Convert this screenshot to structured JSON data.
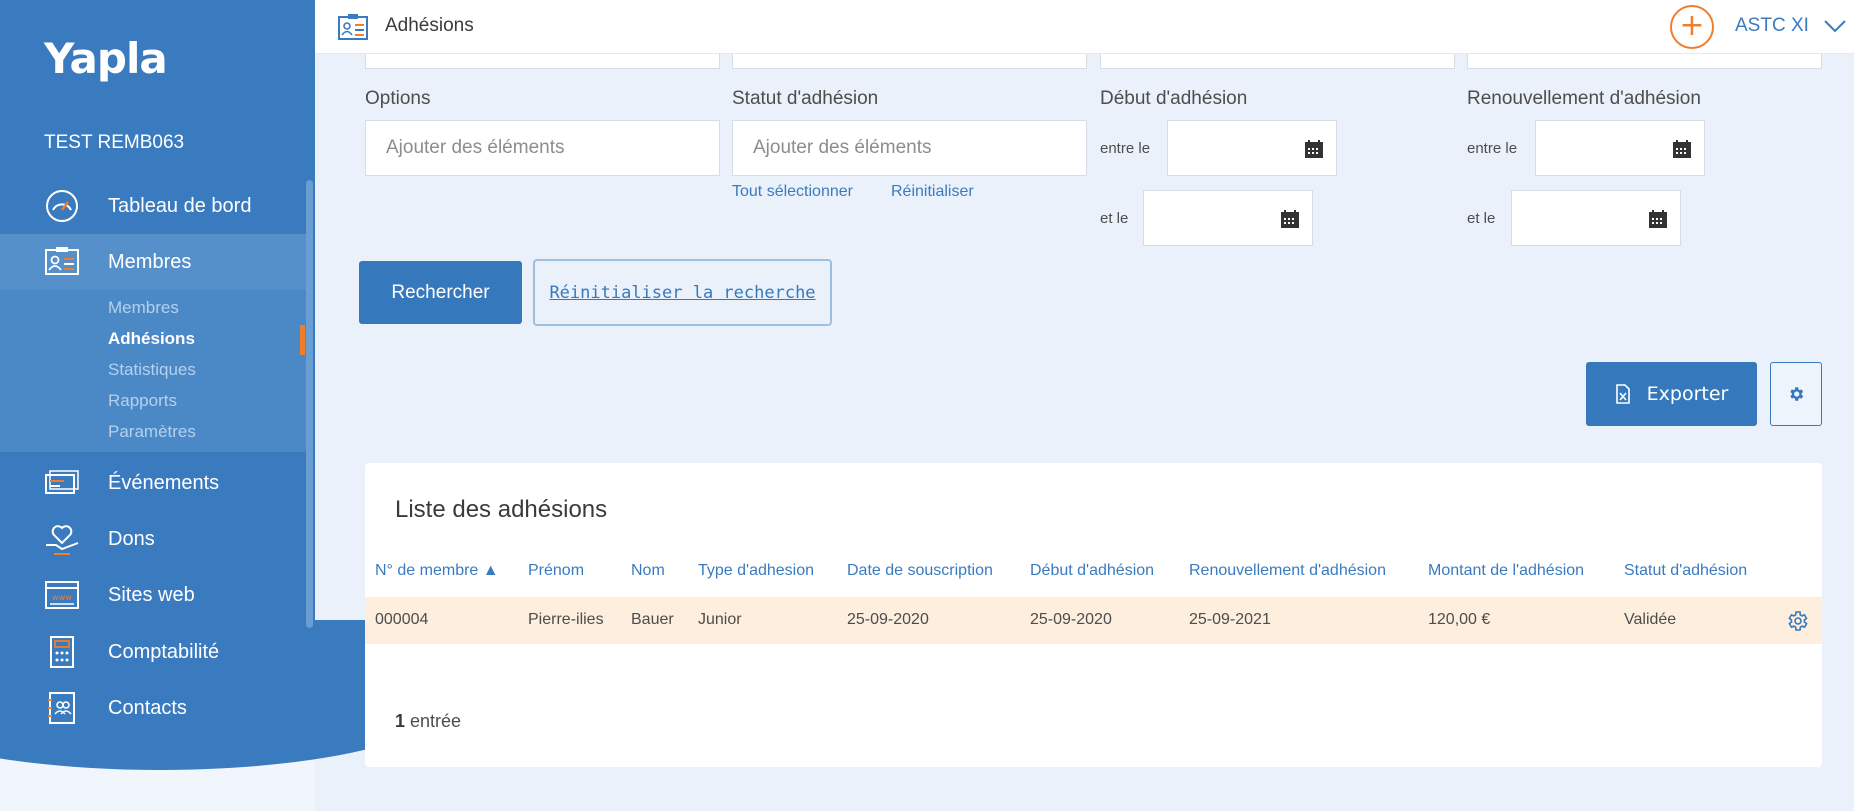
{
  "app": {
    "logo": "Yapla",
    "org_name": "TEST REMB063"
  },
  "sidebar": {
    "items": [
      {
        "label": "Tableau de bord",
        "icon": "dashboard-gauge-icon"
      },
      {
        "label": "Membres",
        "icon": "member-card-icon"
      },
      {
        "label": "Événements",
        "icon": "ticket-icon"
      },
      {
        "label": "Dons",
        "icon": "heart-hand-icon"
      },
      {
        "label": "Sites web",
        "icon": "website-icon"
      },
      {
        "label": "Comptabilité",
        "icon": "calculator-icon"
      },
      {
        "label": "Contacts",
        "icon": "contacts-book-icon"
      }
    ],
    "submenu": [
      "Membres",
      "Adhésions",
      "Statistiques",
      "Rapports",
      "Paramètres"
    ],
    "active_submenu": "Adhésions"
  },
  "topbar": {
    "title": "Adhésions",
    "account": "ASTC XI"
  },
  "filters": {
    "options_label": "Options",
    "options_placeholder": "Ajouter des éléments",
    "status_label": "Statut d'adhésion",
    "status_placeholder": "Ajouter des éléments",
    "select_all": "Tout sélectionner",
    "reset": "Réinitialiser",
    "start_label": "Début d'adhésion",
    "renewal_label": "Renouvellement d'adhésion",
    "between": "entre le",
    "and": "et le"
  },
  "actions": {
    "search": "Rechercher",
    "reset_search": "Réinitialiser la recherche",
    "export": "Exporter"
  },
  "table": {
    "title": "Liste des adhésions",
    "columns": [
      "N° de membre ▲",
      "Prénom",
      "Nom",
      "Type d'adhesion",
      "Date de souscription",
      "Début d'adhésion",
      "Renouvellement d'adhésion",
      "Montant de l'adhésion",
      "Statut d'adhésion"
    ],
    "rows": [
      [
        "000004",
        "Pierre-ilies",
        "Bauer",
        "Junior",
        "25-09-2020",
        "25-09-2020",
        "25-09-2021",
        "120,00 €",
        "Validée"
      ]
    ],
    "count_number": "1",
    "count_label": "entrée"
  },
  "colors": {
    "primary": "#3579bc",
    "sidebar": "#3a7bbf",
    "accent": "#f07d2b",
    "row_highlight": "#fdeedd"
  }
}
